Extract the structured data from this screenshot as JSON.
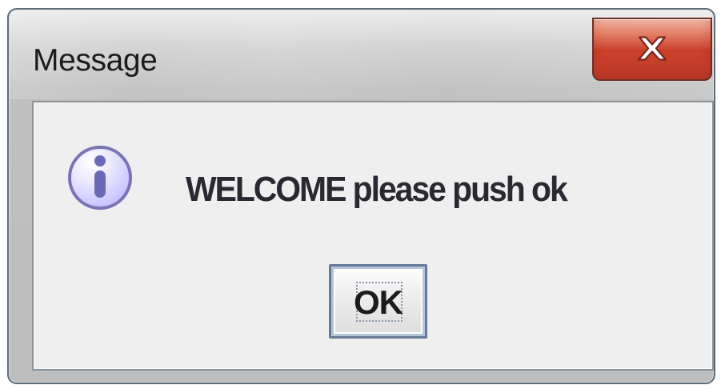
{
  "window": {
    "title": "Message"
  },
  "dialog": {
    "message": "WELCOME please push ok",
    "ok_label": "OK",
    "icon": "info-icon",
    "close_icon": "close-icon"
  },
  "colors": {
    "close_button": "#c9402b",
    "info_icon_fill": "#d7d3ff",
    "info_icon_stroke": "#7a74b6",
    "content_background": "#efefef"
  }
}
